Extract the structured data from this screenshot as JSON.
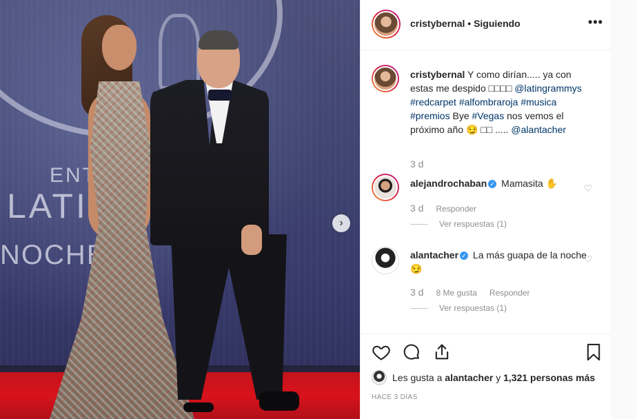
{
  "photo": {
    "backdrop_text": {
      "ent": "ENT",
      "latin": "LATIN",
      "noche": "NOCHE"
    },
    "next_glyph": "›"
  },
  "header": {
    "username": "cristybernal",
    "separator": " • ",
    "follow_status": "Siguiendo",
    "more_glyph": "•••"
  },
  "caption": {
    "username": "cristybernal",
    "text_1": " Y como dirían..... ya con estas me despido ",
    "emoji_placeholder": "□□□□",
    "tag_1": "@latingrammys",
    "tag_2": "#redcarpet",
    "tag_3": "#alfombraroja",
    "tag_4": "#musica",
    "tag_5": "#premios",
    "text_2": " Bye ",
    "tag_6": "#Vegas",
    "text_3": " nos vemos el próximo año ",
    "emoji_wink": "😏",
    "emoji_2": "□□",
    "text_4": " ..... ",
    "tag_7": "@alantacher",
    "time": "3 d"
  },
  "comments": [
    {
      "username": "alejandrochaban",
      "verified": true,
      "text": " Mamasita ",
      "emoji": "✋",
      "time": "3 d",
      "reply_label": "Responder",
      "view_replies": "Ver respuestas (1)"
    },
    {
      "username": "alantacher",
      "verified": true,
      "text": " La más guapa de la noche ",
      "emoji": "😏",
      "time": "3 d",
      "likes_label": "8 Me gusta",
      "reply_label": "Responder",
      "view_replies": "Ver respuestas (1)"
    }
  ],
  "actions": {
    "likes_prefix": "Les gusta a ",
    "likes_user": "alantacher",
    "likes_join": " y ",
    "likes_count": "1,321 personas más",
    "posted_ago": "HACE 3 DÍAS"
  },
  "icons": {
    "like": "heart-icon",
    "comment": "comment-icon",
    "share": "share-icon",
    "save": "bookmark-icon",
    "more": "more-options-icon"
  },
  "colors": {
    "link": "#003569",
    "verified": "#3897f0",
    "muted": "#8e8e8e",
    "carpet": "#d8121b"
  }
}
